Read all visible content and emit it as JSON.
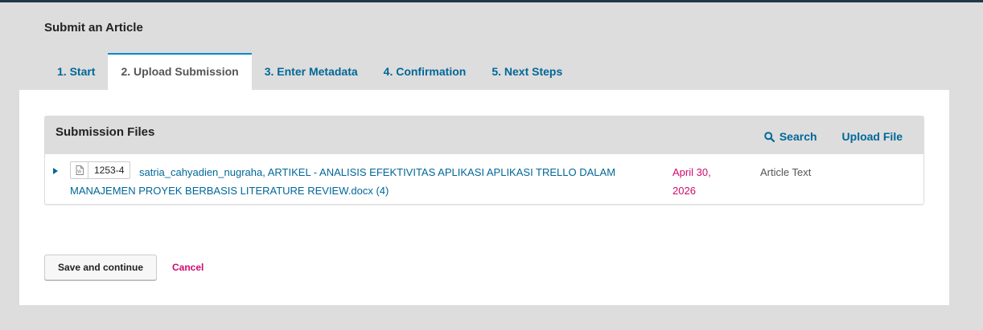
{
  "page": {
    "title": "Submit an Article"
  },
  "tabs": [
    {
      "label": "1. Start"
    },
    {
      "label": "2. Upload Submission",
      "active": true
    },
    {
      "label": "3. Enter Metadata"
    },
    {
      "label": "4. Confirmation"
    },
    {
      "label": "5. Next Steps"
    }
  ],
  "files_panel": {
    "title": "Submission Files",
    "search_label": "Search",
    "upload_label": "Upload File",
    "rows": [
      {
        "file_icon": "word-document-icon",
        "file_id": "1253-4",
        "name": "satria_cahyadien_nugraha, ARTIKEL - ANALISIS EFEKTIVITAS APLIKASI APLIKASI TRELLO DALAM MANAJEMEN PROYEK BERBASIS LITERATURE REVIEW.docx (4)",
        "date": "April 30, 2026",
        "genre": "Article Text"
      }
    ]
  },
  "actions": {
    "save_label": "Save and continue",
    "cancel_label": "Cancel"
  },
  "colors": {
    "link": "#006798",
    "accent": "#d00a6c",
    "tab_border": "#008acb",
    "background": "#dddddd"
  }
}
